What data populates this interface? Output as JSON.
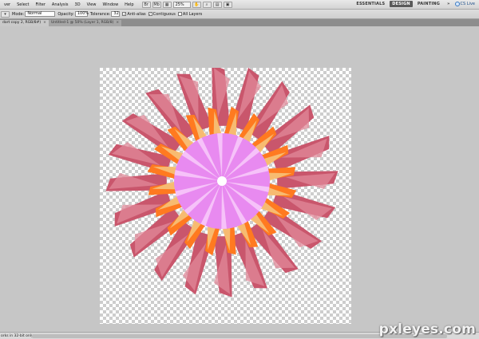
{
  "menubar": {
    "items": [
      "ver",
      "Select",
      "Filter",
      "Analysis",
      "3D",
      "View",
      "Window",
      "Help"
    ],
    "zoom": "25%",
    "workspaces": [
      {
        "label": "ESSENTIALS",
        "active": false
      },
      {
        "label": "DESIGN",
        "active": true
      },
      {
        "label": "PAINTING",
        "active": false
      }
    ],
    "cslive": "CS Live"
  },
  "options": {
    "mode_label": "Mode:",
    "mode_value": "Normal",
    "opacity_label": "Opacity:",
    "opacity_value": "100%",
    "tolerance_label": "Tolerance:",
    "tolerance_value": "32",
    "antialias_label": "Anti-alias",
    "contiguous_label": "Contiguous",
    "alllayers_label": "All Layers"
  },
  "tabs": [
    {
      "label": "dart copy 2, RGB/8#)",
      "active": true
    },
    {
      "label": "Untitled-1 @ 50% (Layer 1, RGB/8)",
      "active": false
    }
  ],
  "status": {
    "text": "orks in 32-bit only"
  },
  "watermark": "pxleyes.com",
  "colors": {
    "petal_outer": "#c9566c",
    "petal_outer_light": "#e08a9a",
    "petal_mid": "#ff7a20",
    "petal_mid_light": "#f6c27a",
    "center": "#e88af0",
    "center_light": "#f7c8fa",
    "checker": "#cdcdcd"
  }
}
